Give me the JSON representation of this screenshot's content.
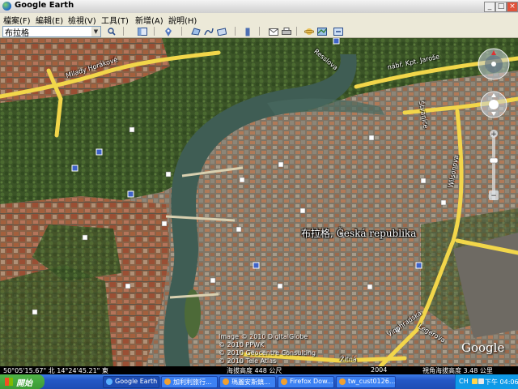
{
  "window": {
    "title": "Google Earth",
    "controls": [
      "minimize-icon",
      "maximize-icon",
      "close-icon"
    ]
  },
  "menu": [
    {
      "label": "檔案(F)",
      "mnemonic": "F"
    },
    {
      "label": "編輯(E)",
      "mnemonic": "E"
    },
    {
      "label": "檢視(V)",
      "mnemonic": "V"
    },
    {
      "label": "工具(T)",
      "mnemonic": "T"
    },
    {
      "label": "新增(A)",
      "mnemonic": "A"
    },
    {
      "label": "說明(H)",
      "mnemonic": "H"
    }
  ],
  "toolbar": {
    "search_value": "布拉格",
    "buttons": [
      "search-icon",
      "sidebar-icon",
      "placemark-icon",
      "polygon-icon",
      "path-icon",
      "overlay-icon",
      "ruler-icon",
      "email-icon",
      "print-icon",
      "sky-icon",
      "maps-icon"
    ]
  },
  "map": {
    "place_label": "布拉格, Česká republika",
    "road_labels": [
      "Milady Horákové",
      "nábř. Kpt. Jaroše",
      "Wilsonova",
      "Vinohradská",
      "Resslova",
      "Žitná",
      "Štvanice",
      "Legerova"
    ],
    "credits": [
      "Image © 2010 DigitalGlobe",
      "© 2010 PPWK",
      "© 2010 Geocentre Consulting",
      "© 2010 Tele Atlas"
    ],
    "brand": "Google"
  },
  "status": {
    "coords": "50°05'15.67\" 北 14°24'45.21\" 東",
    "elevation": "海拔高度 448 公尺",
    "year": "2004",
    "eye_alt": "視角海拔高度 3.48 公里"
  },
  "taskbar": {
    "start": "開始",
    "tasks": [
      {
        "label": "Google Earth",
        "active": true,
        "color": "#59b0ff"
      },
      {
        "label": "加利利旅行...",
        "active": false,
        "color": "#f0a030"
      },
      {
        "label": "瑪麗安斯鎮...",
        "active": false,
        "color": "#f0a030"
      },
      {
        "label": "Firefox Dow...",
        "active": false,
        "color": "#f0a030"
      },
      {
        "label": "tw_cust0126...",
        "active": false,
        "color": "#f0a030"
      }
    ],
    "lang": "CH",
    "clock": "下午 04:06"
  },
  "colors": {
    "river": "#3f5d54",
    "road": "#f2d64a",
    "park": "#3f5a2a",
    "rooftops": "#9a5a3c"
  }
}
